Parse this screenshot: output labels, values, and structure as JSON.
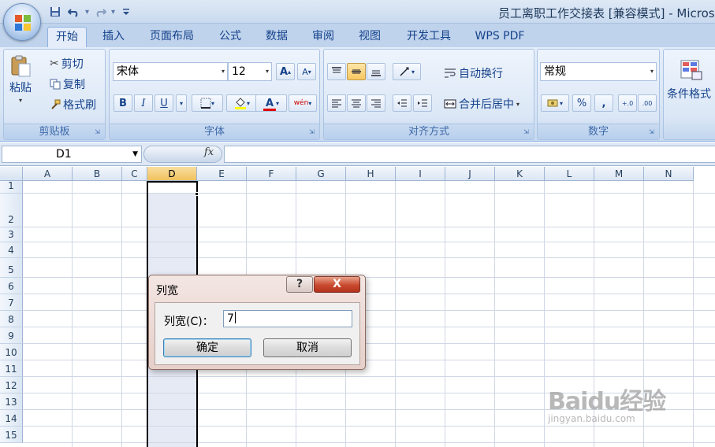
{
  "window": {
    "title": "员工离职工作交接表  [兼容模式] - Micros"
  },
  "quick_access": [
    "save-icon",
    "undo-icon",
    "redo-icon",
    "customize-icon"
  ],
  "tabs": [
    {
      "label": "开始",
      "active": true
    },
    {
      "label": "插入"
    },
    {
      "label": "页面布局"
    },
    {
      "label": "公式"
    },
    {
      "label": "数据"
    },
    {
      "label": "审阅"
    },
    {
      "label": "视图"
    },
    {
      "label": "开发工具"
    },
    {
      "label": "WPS PDF"
    }
  ],
  "ribbon": {
    "clipboard": {
      "label": "剪贴板",
      "paste": "粘贴",
      "cut": "剪切",
      "copy": "复制",
      "format_painter": "格式刷"
    },
    "font": {
      "label": "字体",
      "font_name": "宋体",
      "font_size": "12",
      "grow": "A",
      "shrink": "A",
      "bold": "B",
      "italic": "I",
      "underline": "U",
      "font_color": "A",
      "phonetic": "wén",
      "font_color_hex": "#e00000",
      "highlight_hex": "#ffff00"
    },
    "alignment": {
      "label": "对齐方式",
      "wrap_text": "自动换行",
      "merge_center": "合并后居中"
    },
    "number": {
      "label": "数字",
      "format": "常规",
      "percent": "%",
      "comma": ",",
      "inc_decimal": "+.0",
      "dec_decimal": ".00"
    },
    "styles": {
      "conditional_format": "条件格式"
    }
  },
  "formula_bar": {
    "name_box": "D1",
    "fx": "fx",
    "value": ""
  },
  "sheet": {
    "columns": [
      "A",
      "B",
      "C",
      "D",
      "E",
      "F",
      "G",
      "H",
      "I",
      "J",
      "K",
      "L",
      "M",
      "N"
    ],
    "selected_column": "D",
    "rows": [
      "1",
      "2",
      "3",
      "4",
      "5",
      "6",
      "7",
      "8",
      "9",
      "10",
      "11",
      "12",
      "13",
      "14",
      "15"
    ]
  },
  "dialog": {
    "title": "列宽",
    "help": "?",
    "close": "X",
    "field_label": "列宽(C)：",
    "field_value": "7",
    "ok": "确定",
    "cancel": "取消"
  },
  "watermark": {
    "main": "Baidu经验",
    "sub": "jingyan.baidu.com"
  }
}
